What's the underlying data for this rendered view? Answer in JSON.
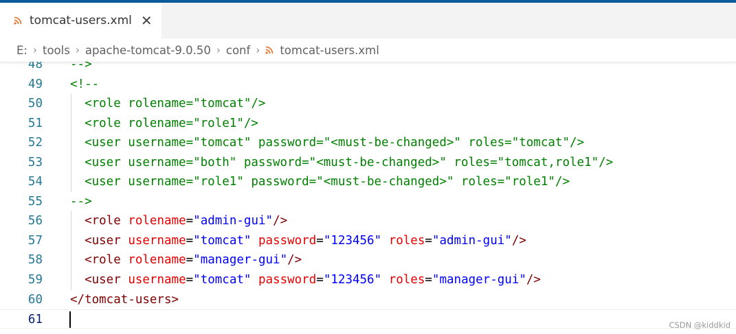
{
  "tab": {
    "title": "tomcat-users.xml",
    "close": "✕",
    "icon": "rss-icon"
  },
  "breadcrumb": {
    "items": [
      "E:",
      "tools",
      "apache-tomcat-9.0.50",
      "conf",
      "tomcat-users.xml"
    ],
    "separator": "›"
  },
  "editor": {
    "lines": [
      {
        "num": "48",
        "text": "-->"
      },
      {
        "num": "49",
        "text": "<!--"
      },
      {
        "num": "50",
        "text": "  <role rolename=\"tomcat\"/>"
      },
      {
        "num": "51",
        "text": "  <role rolename=\"role1\"/>"
      },
      {
        "num": "52",
        "text": "  <user username=\"tomcat\" password=\"<must-be-changed>\" roles=\"tomcat\"/>"
      },
      {
        "num": "53",
        "text": "  <user username=\"both\" password=\"<must-be-changed>\" roles=\"tomcat,role1\"/>"
      },
      {
        "num": "54",
        "text": "  <user username=\"role1\" password=\"<must-be-changed>\" roles=\"role1\"/>"
      },
      {
        "num": "55",
        "text": "-->"
      },
      {
        "num": "56",
        "tokens": [
          [
            "  ",
            ""
          ],
          [
            "<role",
            "c-tag"
          ],
          [
            " ",
            ""
          ],
          [
            "rolename",
            "c-attr"
          ],
          [
            "=",
            "c-eq"
          ],
          [
            "\"admin-gui\"",
            "c-val"
          ],
          [
            "/>",
            "c-tag"
          ]
        ]
      },
      {
        "num": "57",
        "tokens": [
          [
            "  ",
            ""
          ],
          [
            "<user",
            "c-tag"
          ],
          [
            " ",
            ""
          ],
          [
            "username",
            "c-attr"
          ],
          [
            "=",
            "c-eq"
          ],
          [
            "\"tomcat\"",
            "c-val"
          ],
          [
            " ",
            ""
          ],
          [
            "password",
            "c-attr"
          ],
          [
            "=",
            "c-eq"
          ],
          [
            "\"123456\"",
            "c-val"
          ],
          [
            " ",
            ""
          ],
          [
            "roles",
            "c-attr"
          ],
          [
            "=",
            "c-eq"
          ],
          [
            "\"admin-gui\"",
            "c-val"
          ],
          [
            "/>",
            "c-tag"
          ]
        ]
      },
      {
        "num": "58",
        "tokens": [
          [
            "  ",
            ""
          ],
          [
            "<role",
            "c-tag"
          ],
          [
            " ",
            ""
          ],
          [
            "rolename",
            "c-attr"
          ],
          [
            "=",
            "c-eq"
          ],
          [
            "\"manager-gui\"",
            "c-val"
          ],
          [
            "/>",
            "c-tag"
          ]
        ]
      },
      {
        "num": "59",
        "tokens": [
          [
            "  ",
            ""
          ],
          [
            "<user",
            "c-tag"
          ],
          [
            " ",
            ""
          ],
          [
            "username",
            "c-attr"
          ],
          [
            "=",
            "c-eq"
          ],
          [
            "\"tomcat\"",
            "c-val"
          ],
          [
            " ",
            ""
          ],
          [
            "password",
            "c-attr"
          ],
          [
            "=",
            "c-eq"
          ],
          [
            "\"123456\"",
            "c-val"
          ],
          [
            " ",
            ""
          ],
          [
            "roles",
            "c-attr"
          ],
          [
            "=",
            "c-eq"
          ],
          [
            "\"manager-gui\"",
            "c-val"
          ],
          [
            "/>",
            "c-tag"
          ]
        ]
      },
      {
        "num": "60",
        "tokens": [
          [
            "</tomcat-users>",
            "c-tag"
          ]
        ]
      },
      {
        "num": "61",
        "tokens": []
      }
    ],
    "comment_lines": [
      "48",
      "49",
      "50",
      "51",
      "52",
      "53",
      "54",
      "55"
    ],
    "guide_lines": [
      "50",
      "51",
      "52",
      "53",
      "54",
      "56",
      "57",
      "58",
      "59"
    ],
    "current_line": "61"
  },
  "colors": {
    "accent": "#0a5a9c",
    "comment": "#008000",
    "tag": "#800000",
    "attribute": "#e50000",
    "value": "#0000ff",
    "line_number": "#237893",
    "rss_icon": "#e37933"
  },
  "watermark": "CSDN @kiddkid"
}
